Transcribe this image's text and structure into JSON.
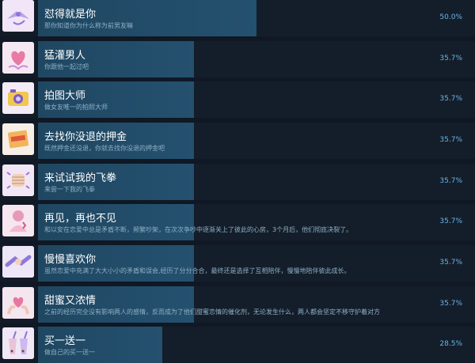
{
  "achievements": [
    {
      "title": "怼得就是你",
      "desc": "那你知道你为什么称为前男友嘛",
      "percent": "50.0%",
      "progress": 0.5,
      "icon": "ribbon-bow-icon",
      "icon_bg": "#f1e6f7"
    },
    {
      "title": "猛灌男人",
      "desc": "你跟他一起过吧",
      "percent": "35.7%",
      "progress": 0.357,
      "icon": "heart-hands-icon",
      "icon_bg": "#f6e8f3"
    },
    {
      "title": "拍图大师",
      "desc": "做女友唯一的拍照大师",
      "percent": "35.7%",
      "progress": 0.357,
      "icon": "camera-icon",
      "icon_bg": "#f3ecf7"
    },
    {
      "title": "去找你没退的押金",
      "desc": "既然押金还没退，你就去找你没退的押金吧",
      "percent": "35.7%",
      "progress": 0.357,
      "icon": "deposit-stamp-icon",
      "icon_bg": "#f7efe6"
    },
    {
      "title": "来试试我的飞拳",
      "desc": "来尝一下我的飞拳",
      "percent": "35.7%",
      "progress": 0.357,
      "icon": "fist-icon",
      "icon_bg": "#f1e6f5"
    },
    {
      "title": "再见，再也不见",
      "desc": "和以安在恋爱中总是矛盾不断，频繁吵架，在次次争吵中逐渐关上了彼此的心房，3个月后，他们彻底决裂了。",
      "percent": "35.7%",
      "progress": 0.357,
      "icon": "broken-heart-girl-icon",
      "icon_bg": "#f5e6ef"
    },
    {
      "title": "慢慢喜欢你",
      "desc": "虽然恋爱中充满了大大小小的矛盾和误会,经历了分分合合，最终还是选择了互相陪伴，慢慢地陪伴彼此成长。",
      "percent": "35.7%",
      "progress": 0.357,
      "icon": "handshake-icon",
      "icon_bg": "#ede6f7"
    },
    {
      "title": "甜蜜又浓情",
      "desc": "之前的经历完全没有影响两人的感情，反而成为了他们甜蜜恋情的催化剂，无论发生什么，两人都会坚定不移守护着对方",
      "percent": "35.7%",
      "progress": 0.357,
      "icon": "heart-gesture-icon",
      "icon_bg": "#f4e6ef"
    },
    {
      "title": "买一送一",
      "desc": "做自己的买一送一",
      "percent": "28.5%",
      "progress": 0.285,
      "icon": "milk-tea-icon",
      "icon_bg": "#efe7f6"
    }
  ]
}
